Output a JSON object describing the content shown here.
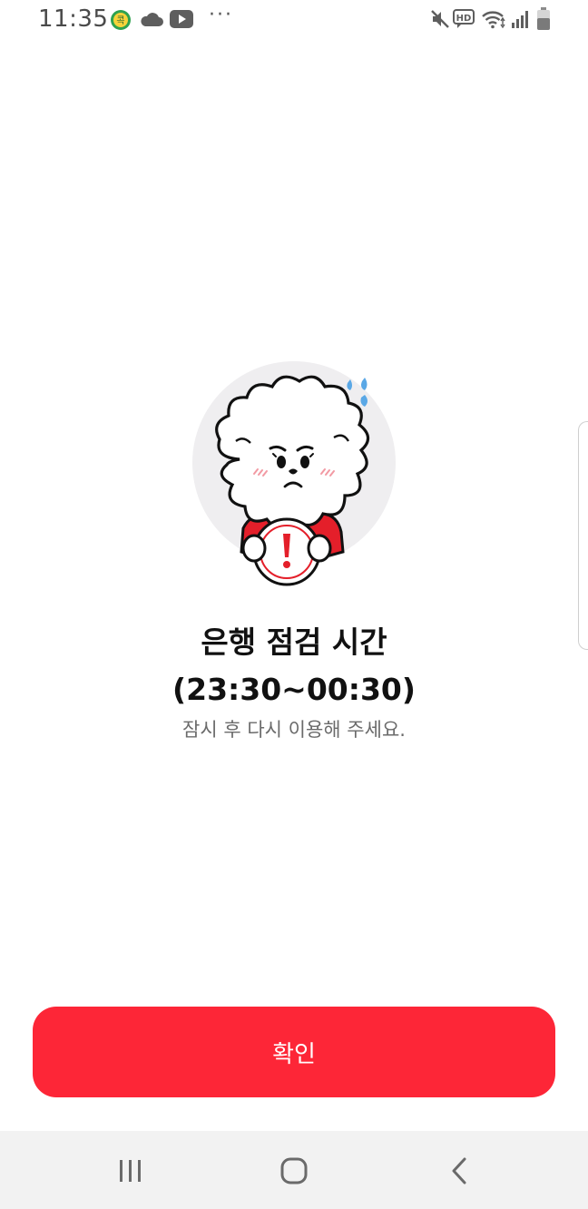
{
  "status_bar": {
    "time": "11:35",
    "icons": [
      "kakao-app-icon",
      "cloud-icon",
      "youtube-icon",
      "more-dots-icon",
      "mute-icon",
      "hd-voice-icon",
      "wifi-icon",
      "signal-icon",
      "battery-icon"
    ],
    "dots": "···"
  },
  "main": {
    "illustration": "worried-poodle-character-holding-warning-sign",
    "title_line1": "은행 점검 시간",
    "title_line2": "(23:30~00:30)",
    "subtitle": "잠시 후 다시 이용해 주세요."
  },
  "confirm_button": {
    "label": "확인"
  },
  "nav_bar": {
    "buttons": [
      "recent-apps-icon",
      "home-icon",
      "back-icon"
    ]
  },
  "colors": {
    "accent": "#fd2637",
    "circle_bg": "#efeef0",
    "sweat": "#5aa8e6",
    "nav_bg": "#f2f2f2"
  }
}
